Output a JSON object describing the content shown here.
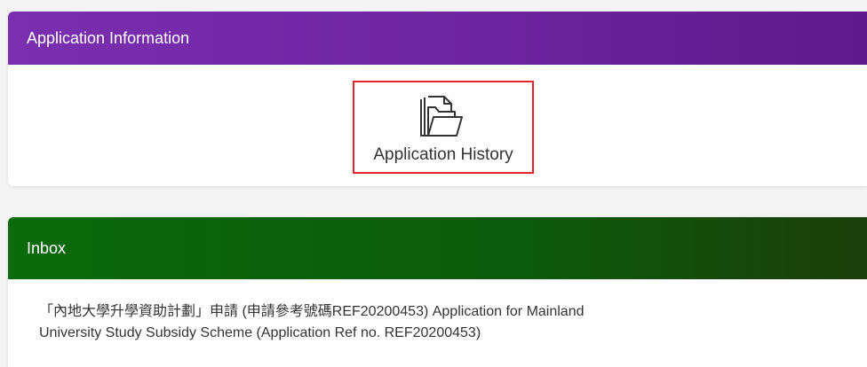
{
  "application_info": {
    "header": "Application Information",
    "history_label": "Application History",
    "history_icon": "folder-icon"
  },
  "inbox": {
    "header": "Inbox",
    "messages": [
      {
        "line1": "「內地大學升學資助計劃」申請 (申請參考號碼REF20200453) Application for Mainland",
        "line2": "University Study Subsidy Scheme (Application Ref no. REF20200453)"
      }
    ]
  },
  "colors": {
    "app_header": "#6d249f",
    "inbox_header": "#0c5a0c",
    "highlight_border": "#e0262b"
  }
}
